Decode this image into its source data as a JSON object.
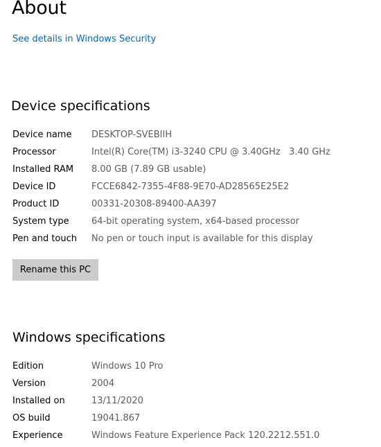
{
  "about": {
    "title": "About",
    "security_link": "See details in Windows Security"
  },
  "device_specifications": {
    "heading": "Device specifications",
    "rows": [
      {
        "label": "Device name",
        "value": "DESKTOP-SVEBIIH"
      },
      {
        "label": "Processor",
        "value": "Intel(R) Core(TM) i3-3240 CPU @ 3.40GHz   3.40 GHz"
      },
      {
        "label": "Installed RAM",
        "value": "8.00 GB (7.89 GB usable)"
      },
      {
        "label": "Device ID",
        "value": "FCCE6842-7355-4F88-9E70-AD28565E25E2"
      },
      {
        "label": "Product ID",
        "value": "00331-20308-89400-AA397"
      },
      {
        "label": "System type",
        "value": "64-bit operating system, x64-based processor"
      },
      {
        "label": "Pen and touch",
        "value": "No pen or touch input is available for this display"
      }
    ],
    "rename_button": "Rename this PC"
  },
  "windows_specifications": {
    "heading": "Windows specifications",
    "rows": [
      {
        "label": "Edition",
        "value": "Windows 10 Pro"
      },
      {
        "label": "Version",
        "value": "2004"
      },
      {
        "label": "Installed on",
        "value": "13/11/2020"
      },
      {
        "label": "OS build",
        "value": "19041.867"
      },
      {
        "label": "Experience",
        "value": "Windows Feature Experience Pack 120.2212.551.0"
      }
    ]
  },
  "colors": {
    "link": "#0067c0",
    "value_text": "#5c5c5c",
    "button_bg": "#cccccc"
  }
}
